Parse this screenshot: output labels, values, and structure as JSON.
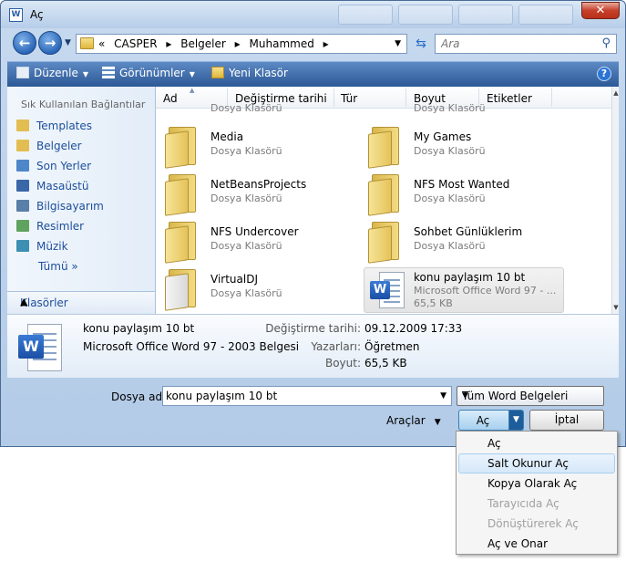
{
  "window": {
    "title": "Aç"
  },
  "address": {
    "crumbs": [
      "«",
      "CASPER",
      "▸",
      "Belgeler",
      "▸",
      "Muhammed",
      "▸"
    ],
    "search_placeholder": "Ara"
  },
  "toolbar": {
    "organize": "Düzenle",
    "views": "Görünümler",
    "new_folder": "Yeni Klasör"
  },
  "sidebar": {
    "heading": "Sık Kullanılan Bağlantılar",
    "items": [
      {
        "label": "Templates",
        "icon": "folder-icon",
        "color": "#e2bd52"
      },
      {
        "label": "Belgeler",
        "icon": "documents-icon",
        "color": "#e2bd52"
      },
      {
        "label": "Son Yerler",
        "icon": "recent-places-icon",
        "color": "#4d86c9"
      },
      {
        "label": "Masaüstü",
        "icon": "desktop-icon",
        "color": "#3a67a8"
      },
      {
        "label": "Bilgisayarım",
        "icon": "computer-icon",
        "color": "#5a7fa8"
      },
      {
        "label": "Resimler",
        "icon": "pictures-icon",
        "color": "#5fa35f"
      },
      {
        "label": "Müzik",
        "icon": "music-icon",
        "color": "#3d8fb3"
      }
    ],
    "more": "Tümü",
    "folders_label": "Klasörler"
  },
  "columns": [
    "Ad",
    "Değiştirme tarihi",
    "Tür",
    "Boyut",
    "Etiketler"
  ],
  "files": {
    "partial_top": [
      "Dosya Klasörü",
      "Dosya Klasörü"
    ],
    "items": [
      {
        "name": "Media",
        "type": "Dosya Klasörü"
      },
      {
        "name": "My Games",
        "type": "Dosya Klasörü"
      },
      {
        "name": "NetBeansProjects",
        "type": "Dosya Klasörü"
      },
      {
        "name": "NFS Most Wanted",
        "type": "Dosya Klasörü"
      },
      {
        "name": "NFS Undercover",
        "type": "Dosya Klasörü"
      },
      {
        "name": "Sohbet Günlüklerim",
        "type": "Dosya Klasörü"
      },
      {
        "name": "VirtualDJ",
        "type": "Dosya Klasörü"
      },
      {
        "name": "konu paylaşım 10 bt",
        "type": "Microsoft Office Word 97 - ...",
        "size": "65,5 KB"
      }
    ]
  },
  "details": {
    "name": "konu paylaşım 10 bt",
    "type": "Microsoft Office Word 97 - 2003 Belgesi",
    "modified_label": "Değiştirme tarihi:",
    "modified_value": "09.12.2009 17:33",
    "authors_label": "Yazarları:",
    "authors_value": "Öğretmen",
    "size_label": "Boyut:",
    "size_value": "65,5 KB"
  },
  "bottom": {
    "filename_label": "Dosya adı:",
    "filename_value": "konu paylaşım 10 bt",
    "filetype_value": "Tüm Word Belgeleri",
    "tools_label": "Araçlar",
    "open_label": "Aç",
    "cancel_label": "İptal"
  },
  "open_menu": [
    {
      "label": "Aç",
      "enabled": true
    },
    {
      "label": "Salt Okunur Aç",
      "enabled": true,
      "hover": true
    },
    {
      "label": "Kopya Olarak Aç",
      "enabled": true
    },
    {
      "label": "Tarayıcıda Aç",
      "enabled": false
    },
    {
      "label": "Dönüştürerek Aç",
      "enabled": false
    },
    {
      "label": "Aç ve Onar",
      "enabled": true
    }
  ]
}
